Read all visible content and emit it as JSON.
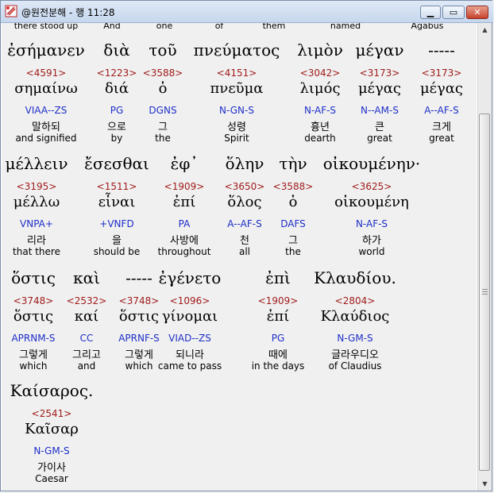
{
  "window": {
    "title": "@원전분해 - 행 11:28"
  },
  "prev_line": [
    "there stood up",
    "And",
    "one",
    "of",
    "them",
    "named",
    "Agabus"
  ],
  "lines": [
    {
      "words": [
        {
          "greek": "ἐσήμανεν",
          "strong": "<4591>",
          "lemma": "σημαίνω",
          "parse": "VIAA--ZS",
          "korean": "말하되",
          "english": "and signified"
        },
        {
          "greek": "διὰ",
          "strong": "<1223>",
          "lemma": "διά",
          "parse": "PG",
          "korean": "으로",
          "english": "by"
        },
        {
          "greek": "τοῦ",
          "strong": "<3588>",
          "lemma": "ὁ",
          "parse": "DGNS",
          "korean": "그",
          "english": "the"
        },
        {
          "greek": "πνεύματος",
          "strong": "<4151>",
          "lemma": "πνεῦμα",
          "parse": "N-GN-S",
          "korean": "성령",
          "english": "Spirit"
        },
        {
          "greek": "λιμὸν",
          "strong": "<3042>",
          "lemma": "λιμός",
          "parse": "N-AF-S",
          "korean": "흉년",
          "english": "dearth"
        },
        {
          "greek": "μέγαν",
          "strong": "<3173>",
          "lemma": "μέγας",
          "parse": "N--AM-S",
          "korean": "큰",
          "english": "great"
        },
        {
          "greek": "-----",
          "strong": "<3173>",
          "lemma": "μέγας",
          "parse": "A--AF-S",
          "korean": "크게",
          "english": "great"
        }
      ]
    },
    {
      "words": [
        {
          "greek": "μέλλειν",
          "strong": "<3195>",
          "lemma": "μέλλω",
          "parse": "VNPA+",
          "korean": "리라",
          "english": "that there"
        },
        {
          "greek": "ἔσεσθαι",
          "strong": "<1511>",
          "lemma": "εἶναι",
          "parse": "+VNFD",
          "korean": "을",
          "english": "should be"
        },
        {
          "greek": "ἐφ᾽",
          "strong": "<1909>",
          "lemma": "ἐπί",
          "parse": "PA",
          "korean": "사방에",
          "english": "throughout"
        },
        {
          "greek": "ὅλην",
          "strong": "<3650>",
          "lemma": "ὅλος",
          "parse": "A--AF-S",
          "korean": "천",
          "english": "all"
        },
        {
          "greek": "τὴν",
          "strong": "<3588>",
          "lemma": "ὁ",
          "parse": "DAFS",
          "korean": "그",
          "english": "the"
        },
        {
          "greek": "οἰκουμένην·",
          "strong": "<3625>",
          "lemma": "οἰκουμένη",
          "parse": "N-AF-S",
          "korean": "하가",
          "english": "world"
        }
      ]
    },
    {
      "words": [
        {
          "greek": "ὅστις",
          "strong": "<3748>",
          "lemma": "ὅστις",
          "parse": "APRNM-S",
          "korean": "그렇게",
          "english": "which"
        },
        {
          "greek": "καὶ",
          "strong": "<2532>",
          "lemma": "καί",
          "parse": "CC",
          "korean": "그리고",
          "english": "and"
        },
        {
          "greek": "-----",
          "strong": "<3748>",
          "lemma": "ὅστις",
          "parse": "APRNF-S",
          "korean": "그렇게",
          "english": "which"
        },
        {
          "greek": "ἐγένετο",
          "strong": "<1096>",
          "lemma": "γίνομαι",
          "parse": "VIAD--ZS",
          "korean": "되니라",
          "english": "came to pass"
        },
        {
          "greek": "ἐπὶ",
          "strong": "<1909>",
          "lemma": "ἐπί",
          "parse": "PG",
          "korean": "때에",
          "english": "in the days"
        },
        {
          "greek": "Κλαυδίου.",
          "strong": "<2804>",
          "lemma": "Κλαύδιος",
          "parse": "N-GM-S",
          "korean": "글라우디오",
          "english": "of Claudius"
        }
      ]
    },
    {
      "words": [
        {
          "greek": "Καίσαρος.",
          "strong": "<2541>",
          "lemma": "Καῖσαρ",
          "parse": "N-GM-S",
          "korean": "가이사",
          "english": "Caesar"
        }
      ]
    }
  ]
}
